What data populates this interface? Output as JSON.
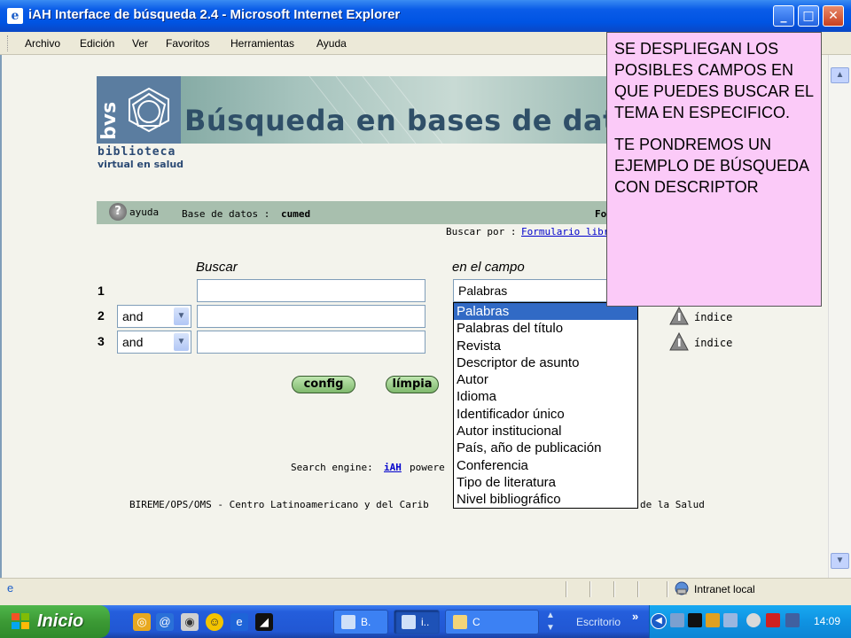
{
  "window": {
    "title": "iAH Interface de búsqueda 2.4 - Microsoft Internet Explorer",
    "minimize_glyph": "_",
    "maximize_glyph": "□",
    "close_glyph": "✕"
  },
  "menu": [
    "Archivo",
    "Edición",
    "Ver",
    "Favoritos",
    "Herramientas",
    "Ayuda"
  ],
  "banner": {
    "logo_text": "bvs",
    "title": "Búsqueda en bases de datos",
    "library_line1": "biblioteca",
    "library_line2": "virtual en salud"
  },
  "infobar": {
    "help_label": "ayuda",
    "db_prefix": "Base de datos :",
    "db_name": "cumed",
    "trailing": "Fo",
    "search_by_prefix": "Buscar por :",
    "search_by_link": "Formulario libr"
  },
  "form": {
    "col_search": "Buscar",
    "col_field": "en el campo",
    "rows": [
      {
        "num": "1",
        "operator": "",
        "field": "Palabras"
      },
      {
        "num": "2",
        "operator": "and",
        "field": ""
      },
      {
        "num": "3",
        "operator": "and",
        "field": ""
      }
    ],
    "index_label": "índice",
    "config_button": "config",
    "clear_button": "límpia"
  },
  "dropdown": {
    "options": [
      "Palabras",
      "Palabras del título",
      "Revista",
      "Descriptor de asunto",
      "Autor",
      "Idioma",
      "Identificador único",
      "Autor institucional",
      "País, año de publicación",
      "Conferencia",
      "Tipo de literatura",
      "Nivel bibliográfico"
    ],
    "selected_index": 0
  },
  "footer": {
    "engine_prefix": "Search engine:",
    "engine_name": "iAH",
    "engine_suffix": "powere",
    "bireme_left": "BIREME/OPS/OMS - Centro Latinoamericano y del Carib",
    "bireme_right": "de la Salud"
  },
  "callout": {
    "paragraph1": "SE DESPLIEGAN LOS POSIBLES CAMPOS EN QUE PUEDES BUSCAR EL TEMA EN ESPECIFICO.",
    "paragraph2": "TE PONDREMOS UN EJEMPLO DE BÚSQUEDA CON DESCRIPTOR"
  },
  "statusbar": {
    "zone": "Intranet local"
  },
  "taskbar": {
    "start_label": "Inicio",
    "items": [
      "B.",
      "i..",
      "C"
    ],
    "desktop_label": "Escritorio",
    "chevron": "»",
    "clock": "14:09"
  },
  "colors": {
    "titlebar_blue": "#0054e3",
    "callout_pink": "#fbcaf8",
    "infobar_green": "#a8bfae",
    "selection_blue": "#316ac5",
    "start_green": "#3c9a35"
  }
}
